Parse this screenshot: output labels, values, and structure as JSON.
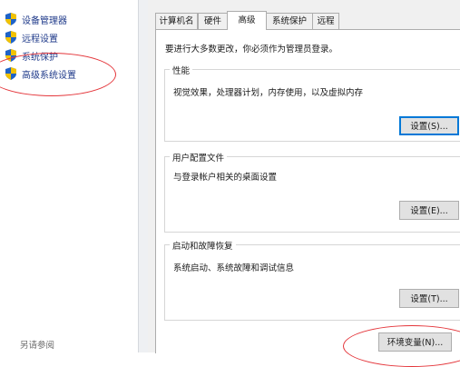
{
  "sidebar": {
    "items": [
      {
        "label": "设备管理器"
      },
      {
        "label": "远程设置"
      },
      {
        "label": "系统保护"
      },
      {
        "label": "高级系统设置"
      }
    ],
    "see_also": "另请参阅"
  },
  "dialog": {
    "tabs": [
      {
        "label": "计算机名"
      },
      {
        "label": "硬件"
      },
      {
        "label": "高级"
      },
      {
        "label": "系统保护"
      },
      {
        "label": "远程"
      }
    ],
    "active_tab": "高级",
    "notice": "要进行大多数更改，你必须作为管理员登录。",
    "performance": {
      "title": "性能",
      "description": "视觉效果，处理器计划，内存使用，以及虚拟内存",
      "button": "设置(S)..."
    },
    "user_profiles": {
      "title": "用户配置文件",
      "description": "与登录帐户相关的桌面设置",
      "button": "设置(E)..."
    },
    "startup_recovery": {
      "title": "启动和故障恢复",
      "description": "系统启动、系统故障和调试信息",
      "button": "设置(T)..."
    },
    "env_button": "环境变量(N)..."
  },
  "colors": {
    "annotation": "#e4353a",
    "link": "#1f3a8a",
    "focus": "#0078d7"
  }
}
